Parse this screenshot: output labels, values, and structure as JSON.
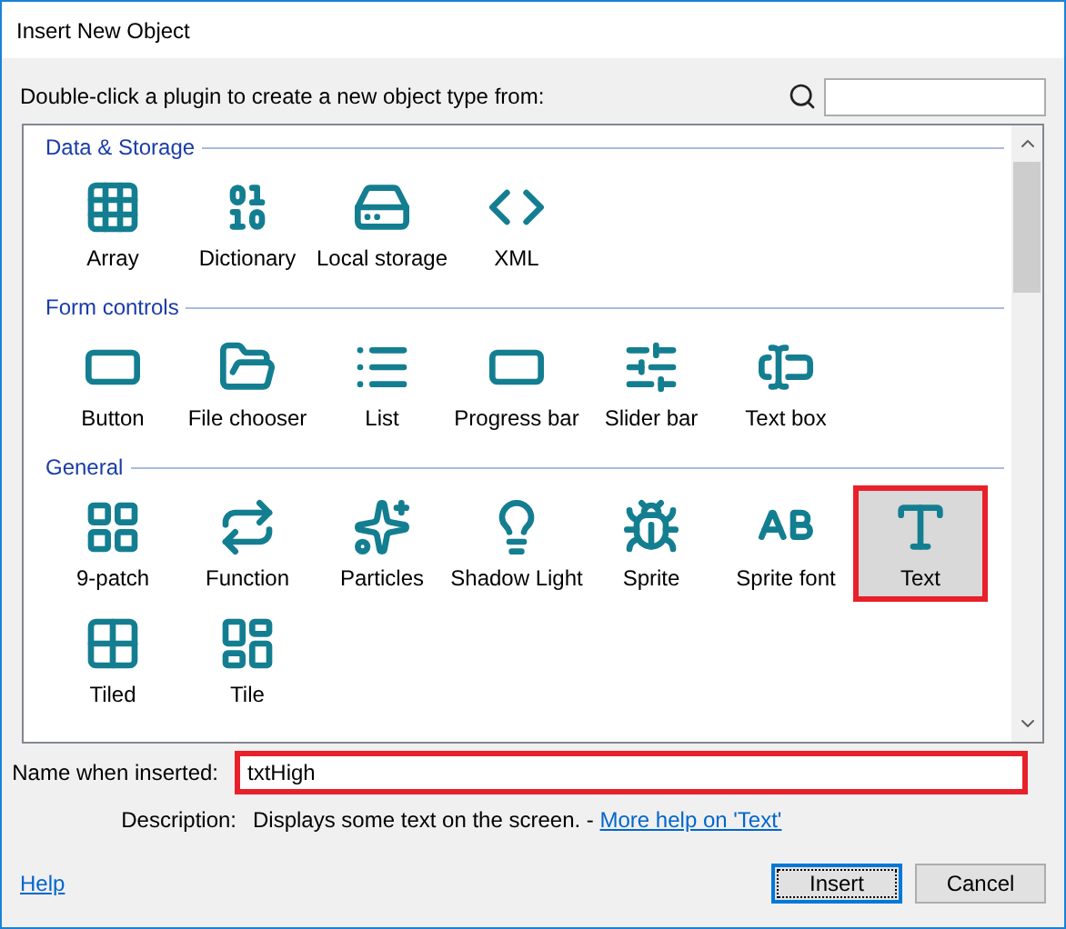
{
  "window": {
    "title": "Insert New Object"
  },
  "instruction": "Double-click a plugin to create a new object type from:",
  "groups": [
    {
      "title": "Data & Storage",
      "items": [
        {
          "label": "Array",
          "kind": "array",
          "selected": false,
          "marked": false
        },
        {
          "label": "Dictionary",
          "kind": "dictionary",
          "selected": false,
          "marked": false
        },
        {
          "label": "Local storage",
          "kind": "storage",
          "selected": false,
          "marked": false
        },
        {
          "label": "XML",
          "kind": "xml",
          "selected": false,
          "marked": false
        }
      ]
    },
    {
      "title": "Form controls",
      "items": [
        {
          "label": "Button",
          "kind": "button",
          "selected": false,
          "marked": false
        },
        {
          "label": "File chooser",
          "kind": "folder",
          "selected": false,
          "marked": false
        },
        {
          "label": "List",
          "kind": "list",
          "selected": false,
          "marked": false
        },
        {
          "label": "Progress bar",
          "kind": "progress",
          "selected": false,
          "marked": false
        },
        {
          "label": "Slider bar",
          "kind": "slider",
          "selected": false,
          "marked": false
        },
        {
          "label": "Text box",
          "kind": "textbox",
          "selected": false,
          "marked": false
        }
      ]
    },
    {
      "title": "General",
      "items": [
        {
          "label": "9-patch",
          "kind": "ninepatch",
          "selected": false,
          "marked": false
        },
        {
          "label": "Function",
          "kind": "function",
          "selected": false,
          "marked": false
        },
        {
          "label": "Particles",
          "kind": "particles",
          "selected": false,
          "marked": false
        },
        {
          "label": "Shadow Light",
          "kind": "bulb",
          "selected": false,
          "marked": false
        },
        {
          "label": "Sprite",
          "kind": "sprite",
          "selected": false,
          "marked": false
        },
        {
          "label": "Sprite font",
          "kind": "spritefont",
          "selected": false,
          "marked": false
        },
        {
          "label": "Text",
          "kind": "text",
          "selected": true,
          "marked": true
        },
        {
          "label": "Tiled",
          "kind": "tiled",
          "selected": false,
          "marked": false
        },
        {
          "label": "Tile",
          "kind": "tilemap",
          "selected": false,
          "marked": false
        }
      ]
    }
  ],
  "name_field": {
    "label": "Name when inserted:",
    "value": "txtHigh",
    "marked": true
  },
  "description": {
    "label": "Description:",
    "text": "Displays some text on the screen. - ",
    "link": "More help on 'Text'"
  },
  "help_link": "Help",
  "buttons": [
    {
      "label": "Insert",
      "default": true
    },
    {
      "label": "Cancel",
      "default": false
    }
  ]
}
